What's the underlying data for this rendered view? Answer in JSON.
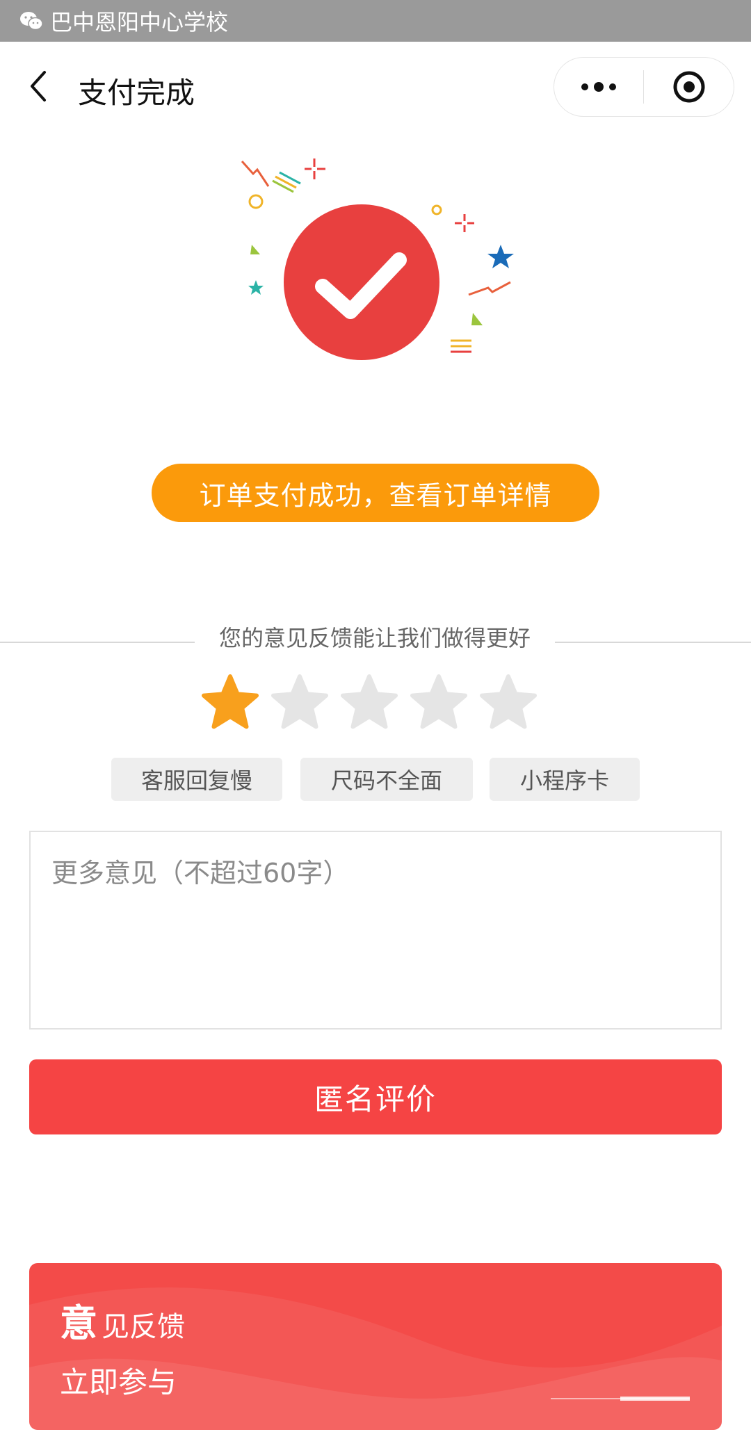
{
  "status_bar": {
    "title": "巴中恩阳中心学校",
    "icon": "wechat-icon"
  },
  "nav": {
    "title": "支付完成",
    "back_icon": "back-arrow-icon",
    "more_icon": "more-dots-icon",
    "close_icon": "target-close-icon"
  },
  "hero": {
    "icon": "success-check-icon",
    "circle_color": "#e8403f"
  },
  "order_button": {
    "label": "订单支付成功，查看订单详情",
    "color": "#fb9a0b"
  },
  "feedback": {
    "prompt": "您的意见反馈能让我们做得更好",
    "rating": {
      "value": 1,
      "max": 5,
      "active_color": "#f8a01d",
      "inactive_color": "#e5e5e5"
    },
    "tags": [
      "客服回复慢",
      "尺码不全面",
      "小程序卡"
    ],
    "textarea_placeholder": "更多意见（不超过60字）",
    "textarea_value": "",
    "submit_label": "匿名评价",
    "submit_color": "#f54444"
  },
  "banner": {
    "title_big": "意",
    "title_rest": "见反馈",
    "subtitle": "立即参与",
    "color": "#f34b49",
    "carousel": {
      "current": 2,
      "total": 2
    }
  }
}
